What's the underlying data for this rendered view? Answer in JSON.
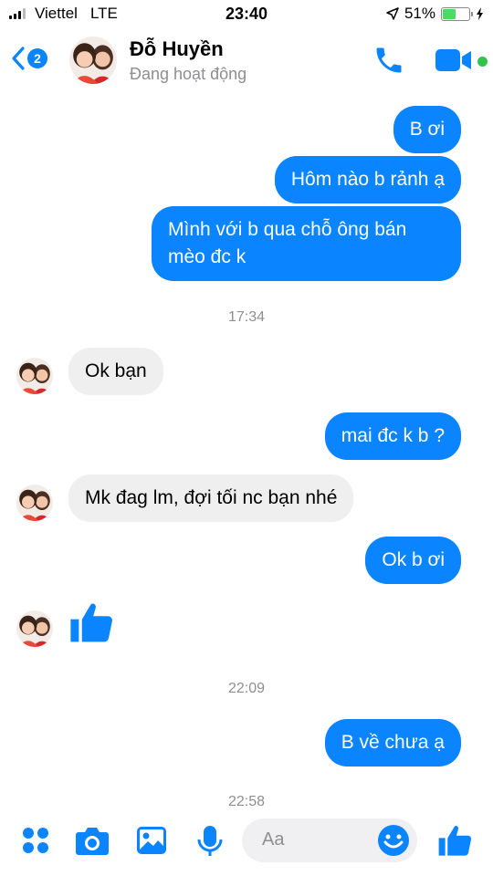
{
  "status_bar": {
    "carrier": "Viettel",
    "network": "LTE",
    "time": "23:40",
    "battery_percent": "51%",
    "battery_level": 0.51
  },
  "header": {
    "name": "Đỗ Huyền",
    "status": "Đang hoạt động",
    "back_badge": "2",
    "accent": "#0a84ff",
    "active_color": "#31c448"
  },
  "messages": {
    "m1": "B ơi",
    "m2": "Hôm nào b rảnh ạ",
    "m3": "Mình với b qua chỗ ông bán mèo đc k",
    "t1": "17:34",
    "m4": "Ok bạn",
    "m5": "mai đc k b ?",
    "m6": "Mk đag lm, đợi tối nc bạn nhé",
    "m7": "Ok b ơi",
    "m8": "like-icon",
    "t2": "22:09",
    "m9": "B về chưa ạ",
    "t3": "22:58"
  },
  "composer": {
    "placeholder": "Aa",
    "icons": [
      "grid-icon",
      "camera-icon",
      "image-icon",
      "microphone-icon",
      "emoji-icon",
      "like-icon"
    ]
  }
}
